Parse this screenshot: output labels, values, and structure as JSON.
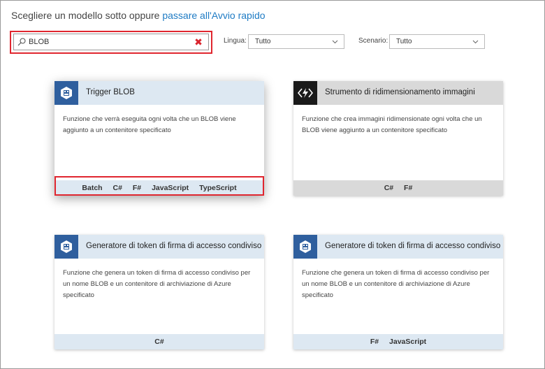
{
  "header": {
    "prefix": "Scegliere un modello sotto oppure ",
    "link": "passare all'Avvio rapido"
  },
  "search": {
    "value": "BLOB"
  },
  "filters": {
    "language_label": "Lingua:",
    "language_value": "Tutto",
    "scenario_label": "Scenario:",
    "scenario_value": "Tutto"
  },
  "cards": [
    {
      "title": "Trigger BLOB",
      "description": "Funzione che verrà eseguita ogni volta che un BLOB viene aggiunto a un contenitore specificato",
      "languages": [
        "Batch",
        "C#",
        "F#",
        "JavaScript",
        "TypeScript"
      ]
    },
    {
      "title": "Strumento di ridimensionamento immagini",
      "description": "Funzione che crea immagini ridimensionate ogni volta che un BLOB viene aggiunto a un contenitore specificato",
      "languages": [
        "C#",
        "F#"
      ]
    },
    {
      "title": "Generatore di token di firma di accesso condiviso",
      "description": "Funzione che genera un token di firma di accesso condiviso per un nome BLOB e un contenitore di archiviazione di Azure specificato",
      "languages": [
        "C#"
      ]
    },
    {
      "title": "Generatore di token di firma di accesso condiviso",
      "description": "Funzione che genera un token di firma di accesso condiviso per un nome BLOB e un contenitore di archiviazione di Azure specificato",
      "languages": [
        "F#",
        "JavaScript"
      ]
    }
  ],
  "colors": {
    "link": "#1e7bc4",
    "highlight": "#e0262f",
    "card_header_blue": "#dde8f2",
    "card_header_gray": "#d9d9d9",
    "icon_blue": "#2f5f9e"
  }
}
